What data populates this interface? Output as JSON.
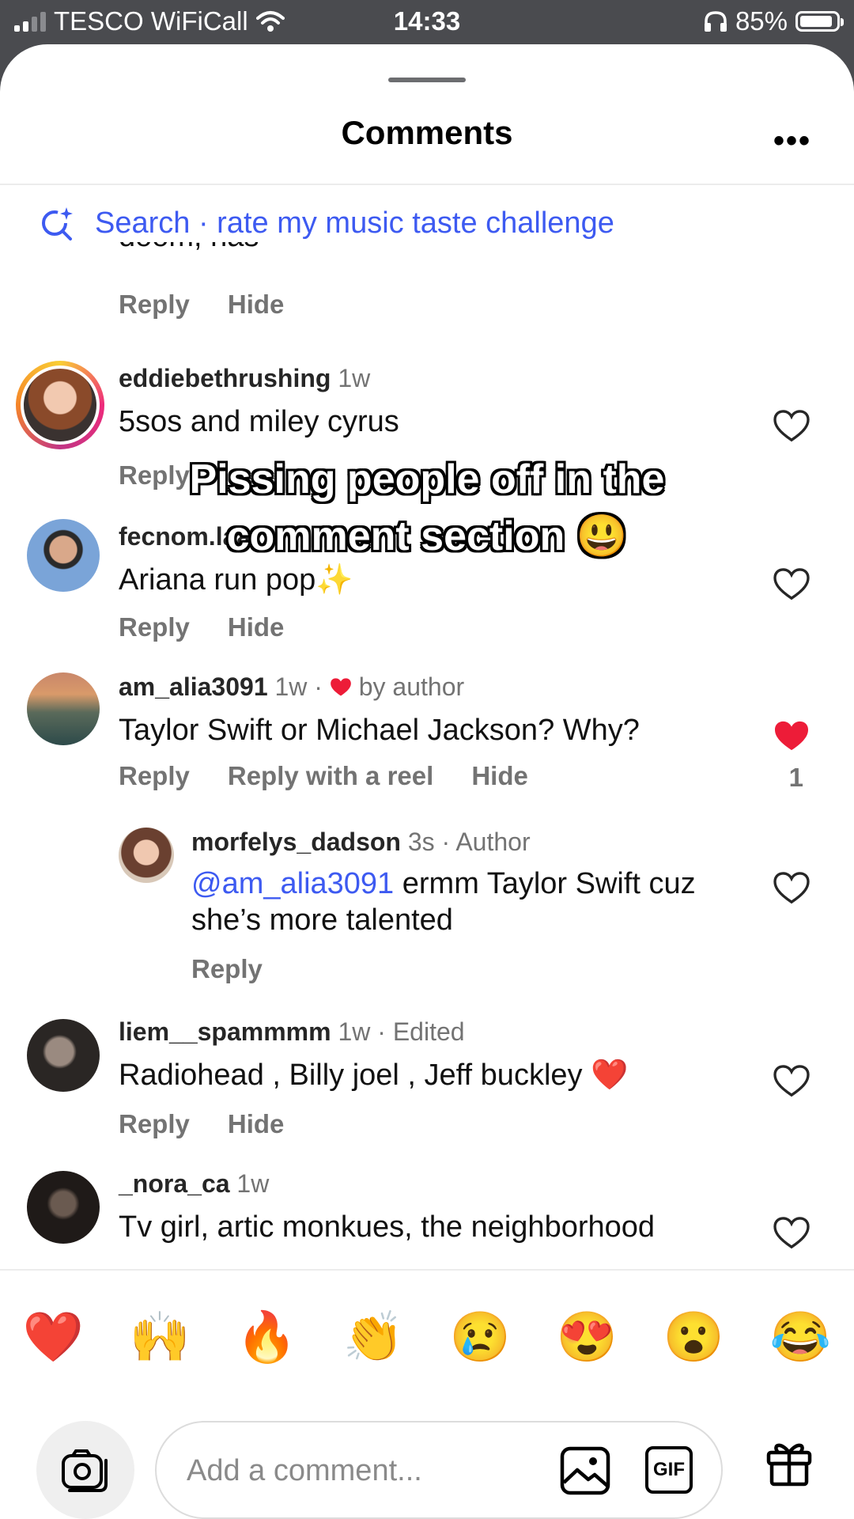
{
  "status_bar": {
    "carrier": "TESCO WiFiCall",
    "time": "14:33",
    "battery": "85%"
  },
  "header": {
    "title": "Comments",
    "more": "•••"
  },
  "search": {
    "label": "Search · rate my music taste challenge"
  },
  "partial_comment": {
    "text": "doom, nas",
    "reply": "Reply",
    "hide": "Hide"
  },
  "overlay_caption": {
    "line1": "Pissing people off in the",
    "line2": "comment section 😃"
  },
  "comments": [
    {
      "user": "eddiebethrushing",
      "time": "1w",
      "text": "5sos and miley cyrus",
      "reply": "Reply",
      "hide": "Hide"
    },
    {
      "user": "fecnom.laa",
      "time": "",
      "text": "Ariana run pop✨",
      "reply": "Reply",
      "hide": "Hide"
    },
    {
      "user": "am_alia3091",
      "time": "1w ·",
      "badge": "by author",
      "text": "Taylor Swift or Michael Jackson? Why?",
      "reply": "Reply",
      "reply_reel": "Reply with a reel",
      "hide": "Hide",
      "likes": "1"
    },
    {
      "user": "morfelys_dadson",
      "time": "3s · Author",
      "mention": "@am_alia3091",
      "text": "ermm Taylor Swift cuz she’s more talented",
      "reply": "Reply"
    },
    {
      "user": "liem__spammmm",
      "time": "1w · Edited",
      "text": "Radiohead , Billy joel , Jeff buckley ❤️",
      "reply": "Reply",
      "hide": "Hide"
    },
    {
      "user": "_nora_ca",
      "time": "1w",
      "text": "Tv girl, artic monkues, the neighborhood"
    }
  ],
  "emoji_bar": [
    "❤️",
    "🙌",
    "🔥",
    "👏",
    "😢",
    "😍",
    "😮",
    "😂"
  ],
  "composer": {
    "placeholder": "Add a comment...",
    "gif_label": "GIF"
  },
  "colors": {
    "accent": "#3d5af1",
    "heart_red": "#ed1c38"
  }
}
